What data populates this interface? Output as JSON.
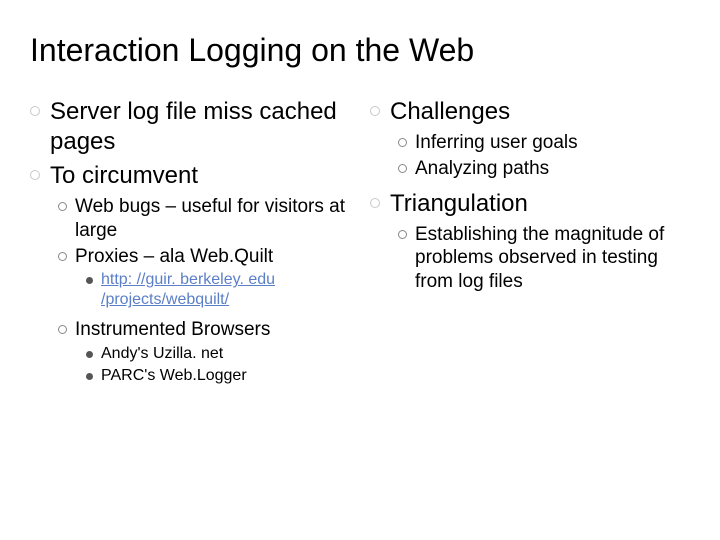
{
  "title": "Interaction Logging on the Web",
  "left": {
    "b1": "Server log file miss cached pages",
    "b2": "To circumvent",
    "b2s1": "Web bugs – useful for visitors at large",
    "b2s2": "Proxies – ala Web.Quilt",
    "b2s2a": "http: //guir. berkeley. edu /projects/webquilt/",
    "b2s3": "Instrumented Browsers",
    "b2s3a": "Andy's Uzilla. net",
    "b2s3b": "PARC's Web.Logger"
  },
  "right": {
    "b1": "Challenges",
    "b1s1": "Inferring user goals",
    "b1s2": "Analyzing paths",
    "b2": "Triangulation",
    "b2s1": "Establishing the magnitude of problems observed in testing from log files"
  }
}
